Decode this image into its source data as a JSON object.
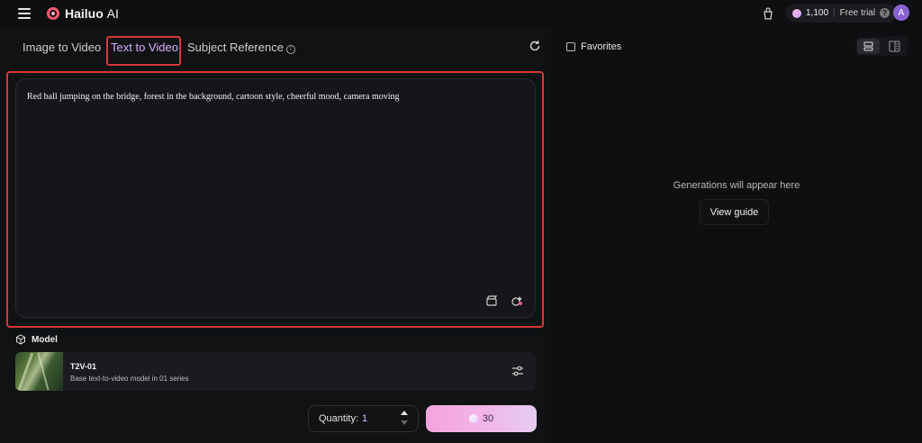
{
  "app": {
    "brand_name": "Hailuo",
    "brand_suffix": "AI",
    "credits": "1,100",
    "trial_label": "Free trial",
    "help_glyph": "?",
    "avatar_initial": "A"
  },
  "tabs": [
    {
      "label": "Image to Video"
    },
    {
      "label": "Text to Video"
    },
    {
      "label": "Subject Reference"
    }
  ],
  "prompt": {
    "value": "Red ball jumping on the bridge, forest in the background, cartoon style, cheerful mood, camera moving"
  },
  "model": {
    "section_label": "Model",
    "name": "T2V-01",
    "description": "Base text-to-video model in 01 series"
  },
  "quantity": {
    "label": "Quantity:",
    "value": "1"
  },
  "generate": {
    "cost": "30"
  },
  "right_panel": {
    "favorites_label": "Favorites",
    "empty_message": "Generations will appear here",
    "guide_button": "View guide"
  },
  "colors": {
    "accent": "#d9b2ff",
    "highlight_box": "#d9383a",
    "generate_gradient_start": "#f4a3dc",
    "generate_gradient_end": "#e6ccf3"
  },
  "icons": {
    "menu": "hamburger-menu-icon",
    "logo": "hailuo-logo-icon",
    "store": "bag-icon",
    "credits": "gem-icon",
    "help": "help-icon",
    "refresh": "refresh-icon",
    "info": "info-icon",
    "prompt_left": "clapperboard-icon",
    "prompt_right": "magic-enhance-icon",
    "model": "cube-icon",
    "settings": "sliders-icon",
    "view_grid": "list-view-icon",
    "view_side": "side-panel-icon"
  }
}
